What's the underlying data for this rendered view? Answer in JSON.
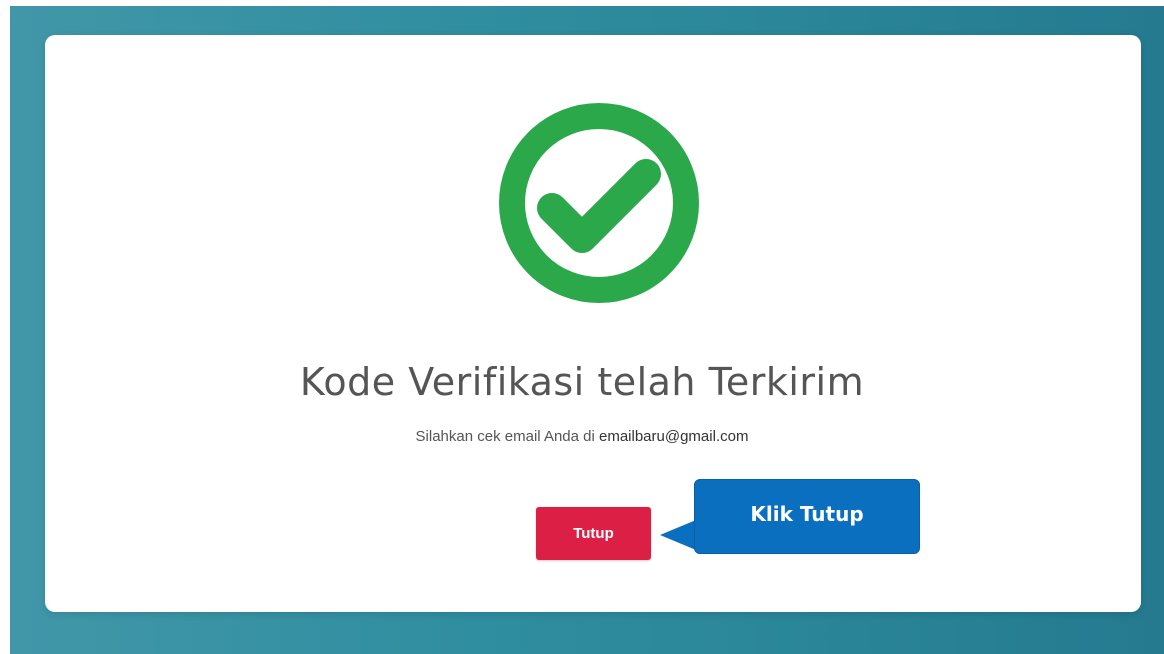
{
  "modal": {
    "title": "Kode Verifikasi telah Terkirim",
    "message_prefix": "Silahkan cek email Anda di ",
    "email": "emailbaru@gmail.com",
    "close_label": "Tutup"
  },
  "annotation": {
    "callout_text": "Klik Tutup"
  },
  "icons": {
    "success": "check-circle-icon"
  },
  "colors": {
    "success_green": "#2aa84a",
    "close_button": "#dc2045",
    "callout_blue": "#0b6fc0",
    "background_teal": "#2f8ea0"
  }
}
